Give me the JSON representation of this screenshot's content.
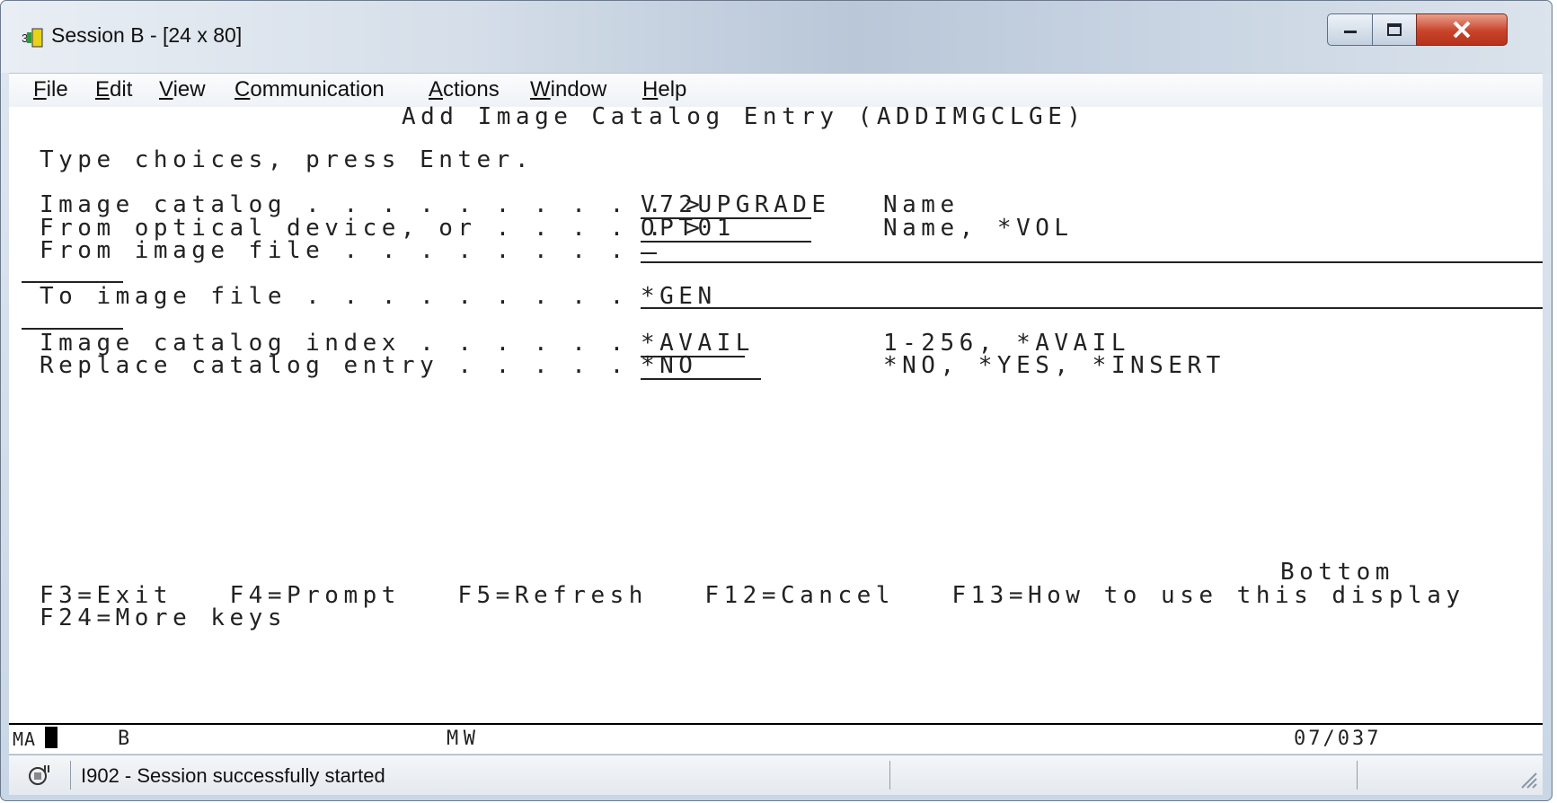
{
  "window": {
    "title": "Session B - [24 x 80]",
    "minimize": "minimize-icon",
    "maximize": "maximize-icon",
    "close": "close-icon"
  },
  "menubar": {
    "items": [
      {
        "label": "File",
        "u": "F",
        "rest": "ile"
      },
      {
        "label": "Edit",
        "u": "E",
        "rest": "dit"
      },
      {
        "label": "View",
        "u": "V",
        "rest": "iew"
      },
      {
        "label": "Communication",
        "u": "C",
        "rest": "ommunication"
      },
      {
        "label": "Actions",
        "u": "A",
        "rest": "ctions"
      },
      {
        "label": "Window",
        "u": "W",
        "rest": "indow"
      },
      {
        "label": "Help",
        "u": "H",
        "rest": "elp"
      }
    ]
  },
  "screen": {
    "title": "Add Image Catalog Entry (ADDIMGCLGE)",
    "instruction": "Type choices, press Enter.",
    "params": [
      {
        "label": "Image catalog . . . . . . . . . . >",
        "value": "V72UPGRADE",
        "hint": "Name"
      },
      {
        "label": "From optical device, or . . . . . >",
        "value": "OPT01",
        "hint": "Name, *VOL"
      },
      {
        "label": "From image file . . . . . . . .",
        "value": "",
        "hint": ""
      },
      {
        "label": "To image file . . . . . . . . .",
        "value": "*GEN",
        "hint": ""
      },
      {
        "label": "Image catalog index . . . . . .",
        "value": "*AVAIL",
        "hint": "1-256, *AVAIL"
      },
      {
        "label": "Replace catalog entry . . . . .",
        "value": "*NO",
        "hint": "*NO, *YES, *INSERT"
      }
    ],
    "more": "Bottom",
    "fkeys_line1": "F3=Exit   F4=Prompt   F5=Refresh   F12=Cancel   F13=How to use this display",
    "fkeys_line2": "F24=More keys"
  },
  "oia": {
    "left": "MA",
    "session": "B",
    "mode": "MW",
    "cursor": "07/037"
  },
  "status": {
    "message": "I902 - Session successfully started"
  }
}
